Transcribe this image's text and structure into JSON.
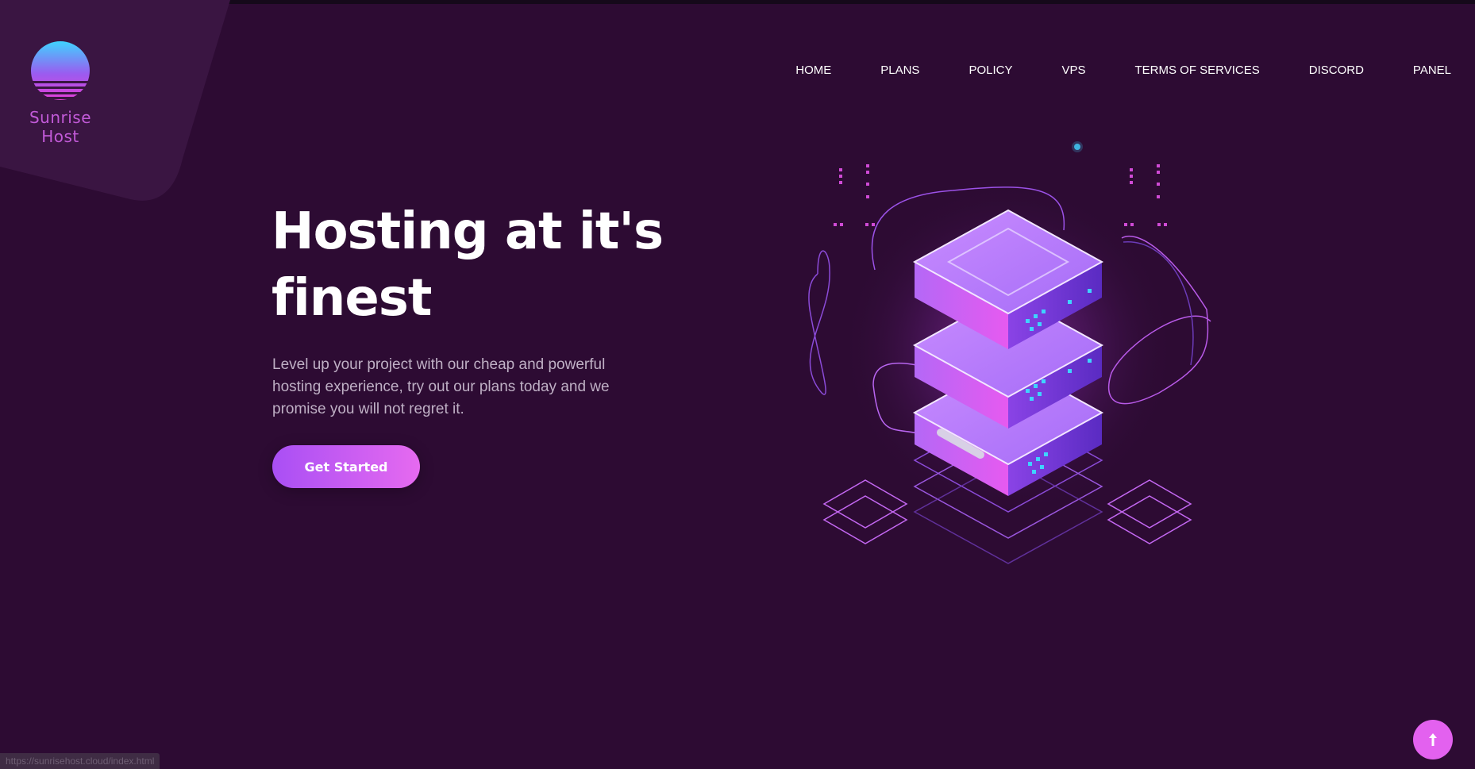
{
  "brand": {
    "name": "Sunrise Host",
    "logo_icon": "sunset-icon"
  },
  "nav": {
    "items": [
      {
        "label": "HOME"
      },
      {
        "label": "PLANS"
      },
      {
        "label": "POLICY"
      },
      {
        "label": "VPS"
      },
      {
        "label": "TERMS OF SERVICES"
      },
      {
        "label": "DISCORD"
      },
      {
        "label": "PANEL"
      }
    ]
  },
  "hero": {
    "title": "Hosting at it's finest",
    "subtitle": "Level up your project with our cheap and powerful hosting experience, try out our plans today and we promise you will not regret it.",
    "cta_label": "Get Started",
    "illustration": "isometric-server-stack-icon"
  },
  "status_bar": {
    "url": "https://sunrisehost.cloud/index.html"
  },
  "back_to_top": {
    "icon": "arrow-up-icon"
  },
  "colors": {
    "background": "#2d0b33",
    "corner_panel": "#3a1542",
    "accent_purple": "#a94ff4",
    "accent_pink": "#e361ef",
    "logo_cyan": "#3fd3ff",
    "brand_text": "#c25ad8"
  }
}
